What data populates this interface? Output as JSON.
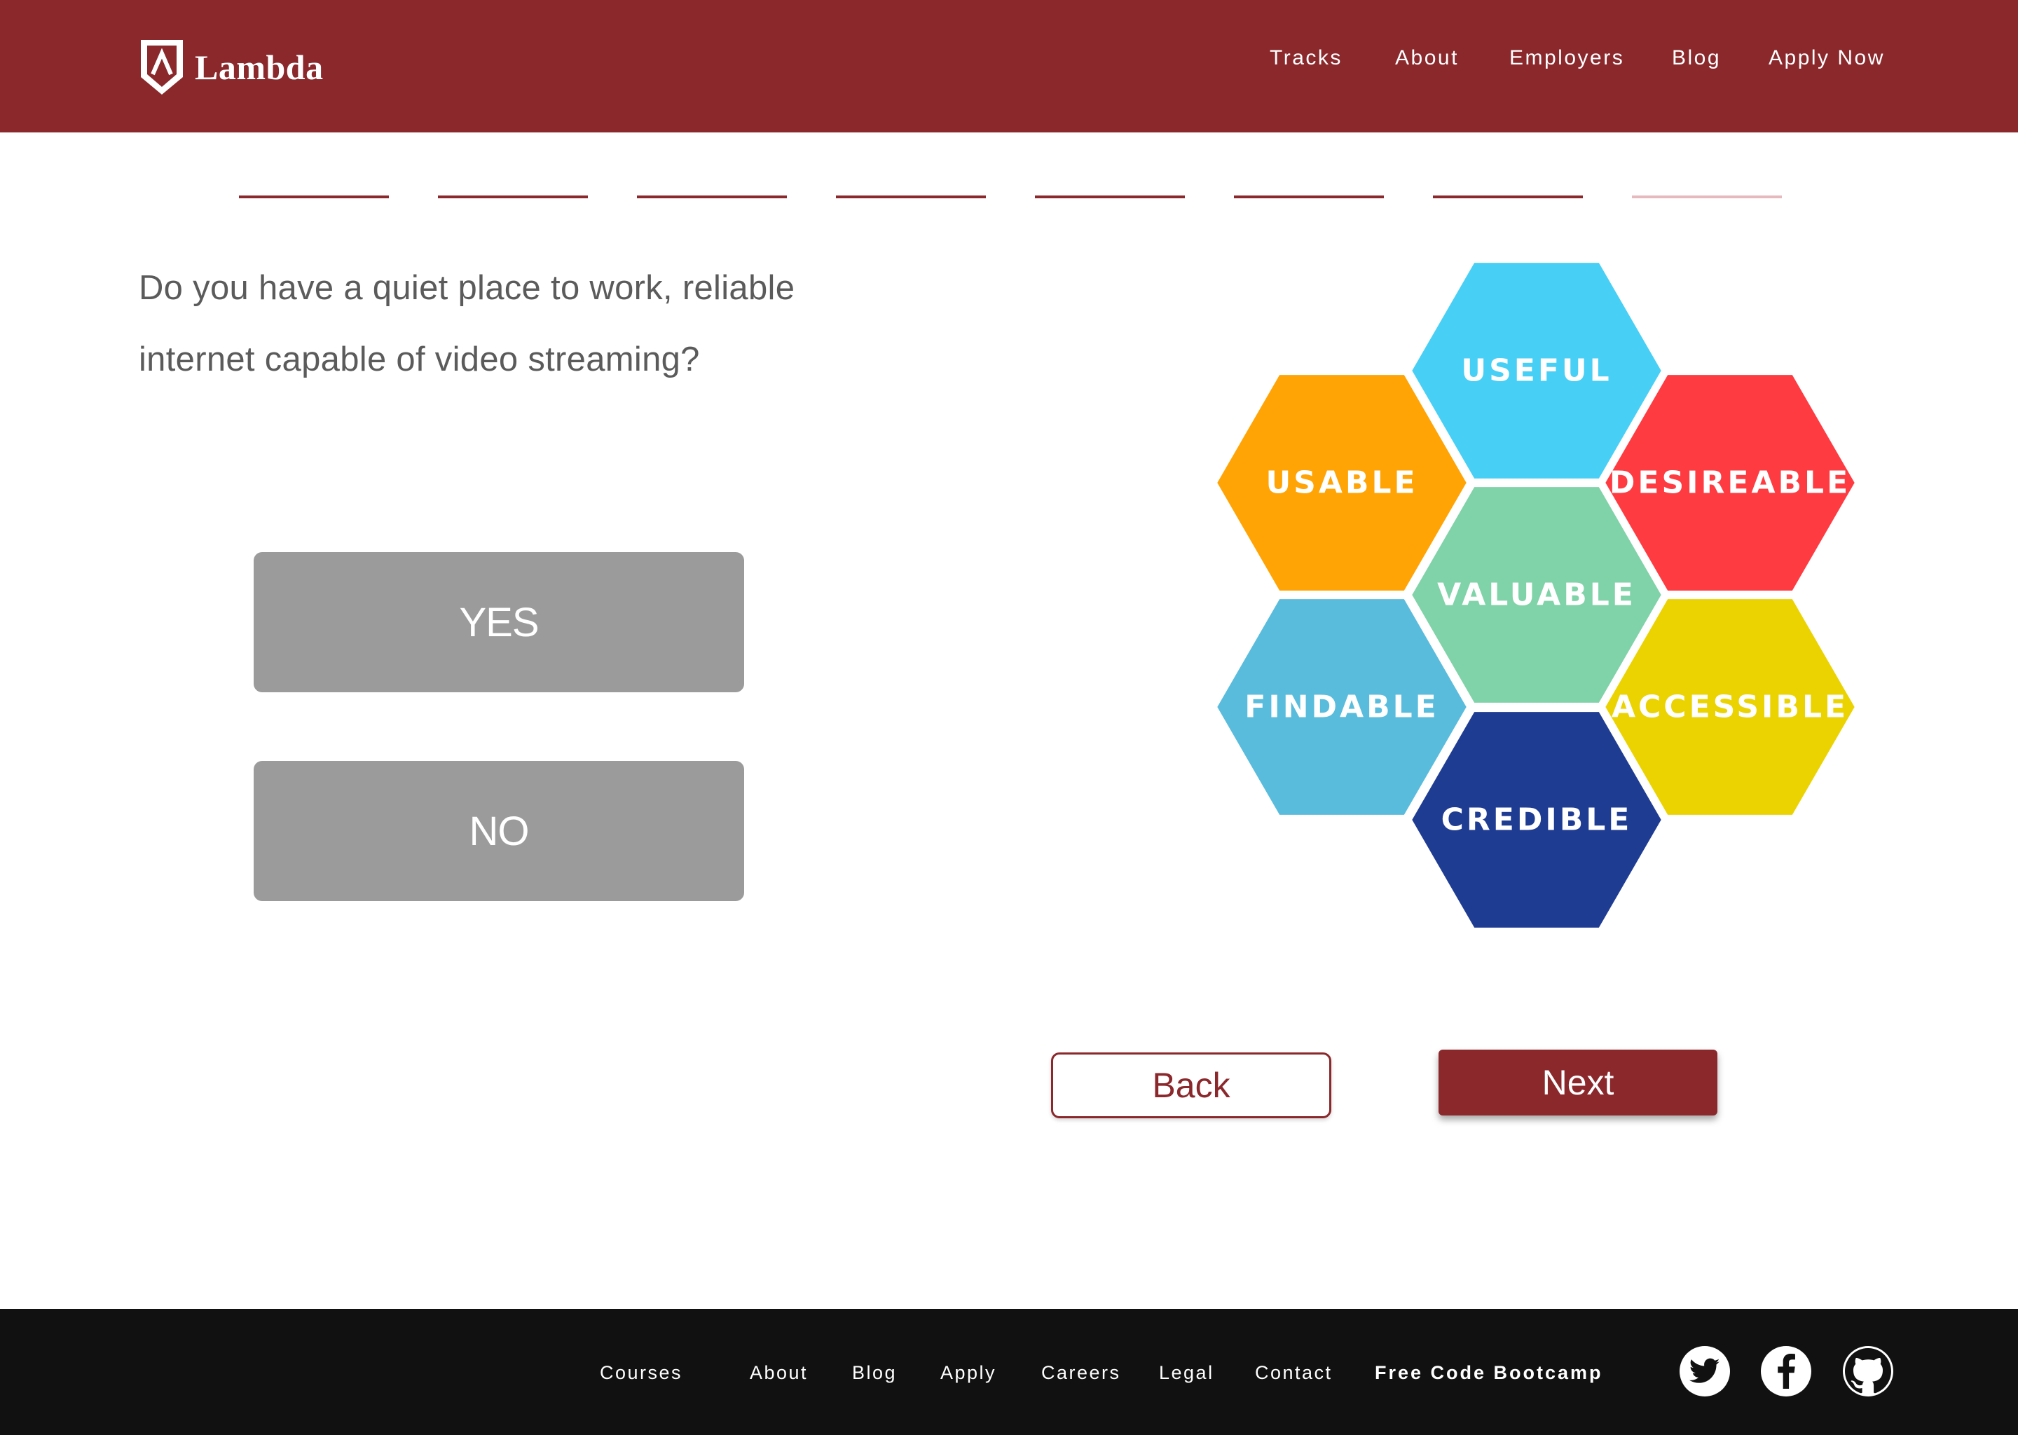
{
  "header": {
    "brand": "Lambda",
    "nav": [
      "Tracks",
      "About",
      "Employers",
      "Blog",
      "Apply Now"
    ]
  },
  "progress": {
    "total_steps": 8,
    "completed_steps": 7
  },
  "question": {
    "line1": "Do you have a quiet place to work, reliable",
    "line2": "internet capable of video streaming?"
  },
  "answers": {
    "yes": "YES",
    "no": "NO"
  },
  "honeycomb": [
    {
      "label": "USEFUL",
      "color": "#48cff5"
    },
    {
      "label": "USABLE",
      "color": "#ffa404"
    },
    {
      "label": "DESIREABLE",
      "color": "#ff3b42"
    },
    {
      "label": "VALUABLE",
      "color": "#80d3a9"
    },
    {
      "label": "FINDABLE",
      "color": "#59bcdc"
    },
    {
      "label": "ACCESSIBLE",
      "color": "#ebd301"
    },
    {
      "label": "CREDIBLE",
      "color": "#1f3c93"
    }
  ],
  "buttons": {
    "back": "Back",
    "next": "Next"
  },
  "footer": {
    "links": [
      "Courses",
      "About",
      "Blog",
      "Apply",
      "Careers",
      "Legal",
      "Contact",
      "Free Code Bootcamp"
    ],
    "social": [
      "twitter-icon",
      "facebook-icon",
      "github-icon"
    ]
  },
  "colors": {
    "brand": "#8a282c",
    "button_gray": "#9b9b9b",
    "footer_bg": "#111111",
    "text_gray": "#5b5b5b"
  }
}
